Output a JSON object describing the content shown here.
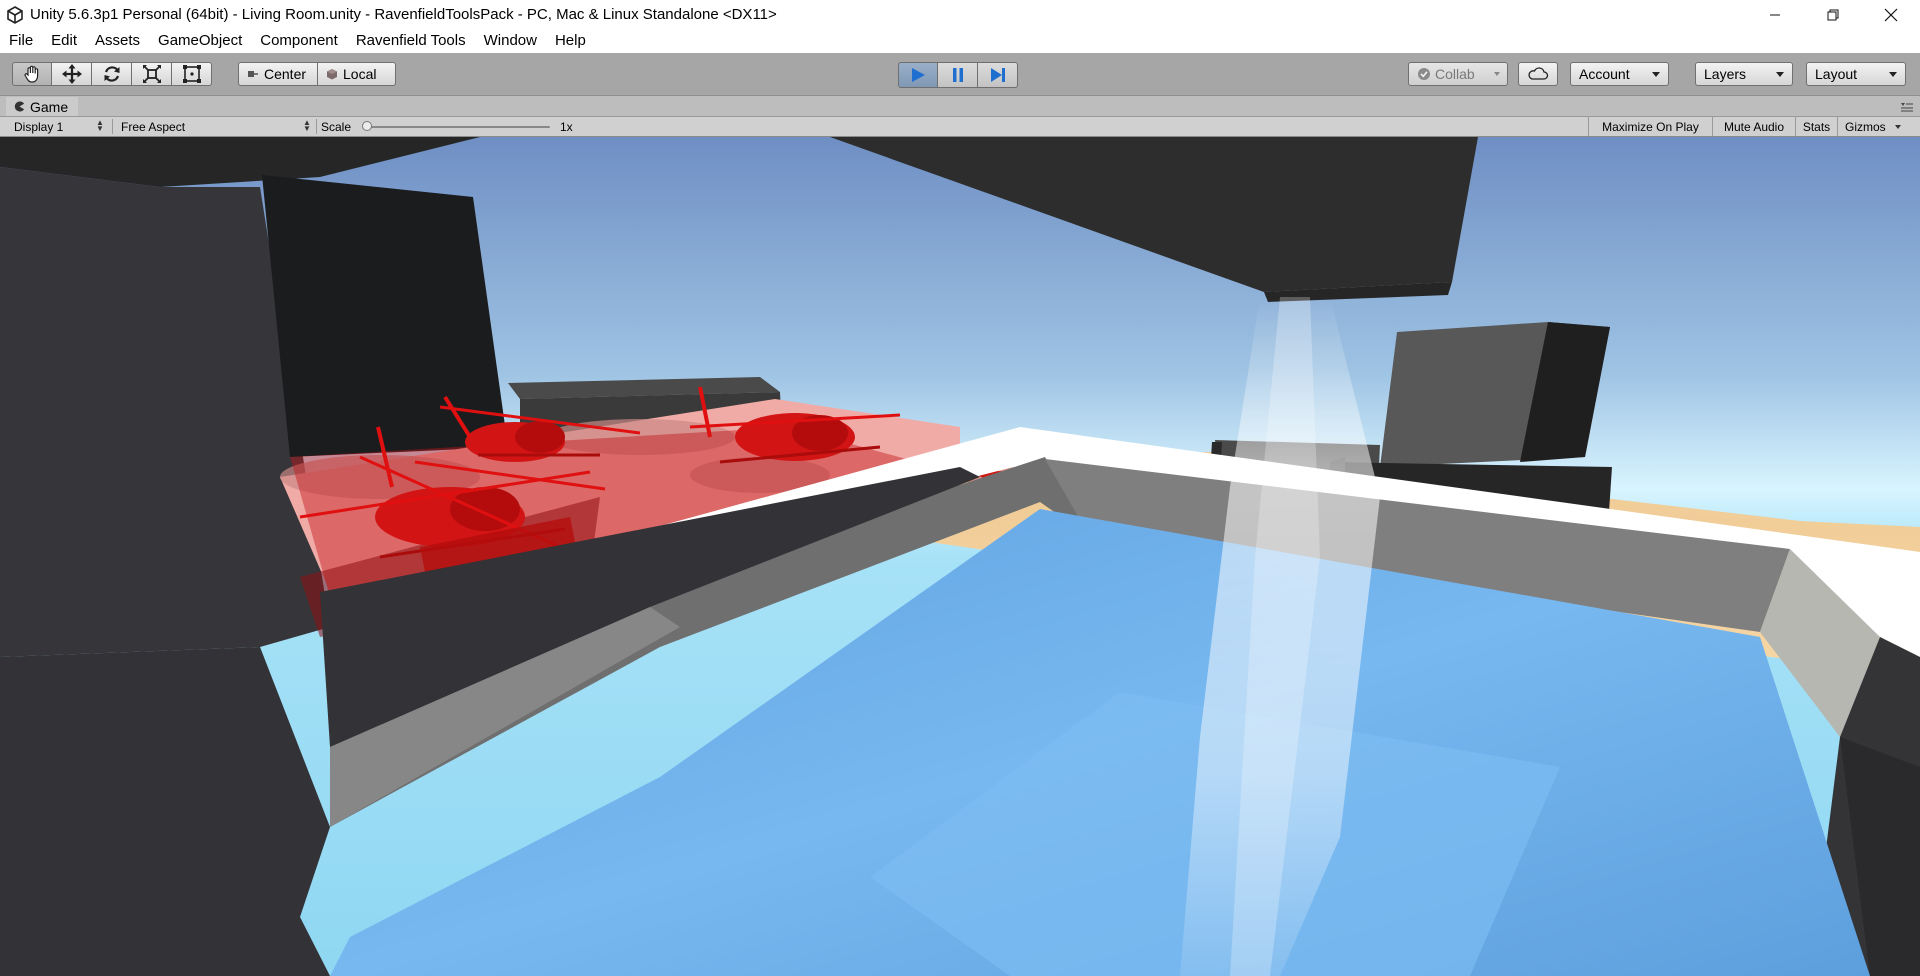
{
  "window": {
    "title": "Unity 5.6.3p1 Personal (64bit) - Living Room.unity - RavenfieldToolsPack - PC, Mac & Linux Standalone <DX11>"
  },
  "menu": {
    "items": [
      "File",
      "Edit",
      "Assets",
      "GameObject",
      "Component",
      "Ravenfield Tools",
      "Window",
      "Help"
    ]
  },
  "toolbar": {
    "tools": [
      "hand-tool-icon",
      "move-tool-icon",
      "rotate-tool-icon",
      "scale-tool-icon",
      "rect-tool-icon"
    ],
    "pivot_mode": "Center",
    "pivot_rotation": "Local",
    "collab": "Collab",
    "account": "Account",
    "layers": "Layers",
    "layout": "Layout"
  },
  "game_view": {
    "tab_label": "Game",
    "display": "Display 1",
    "aspect": "Free Aspect",
    "scale_label": "Scale",
    "scale_value": "1x",
    "scale_level": 0,
    "maximize_on_play": "Maximize On Play",
    "mute_audio": "Mute Audio",
    "stats": "Stats",
    "gizmos": "Gizmos"
  },
  "colors": {
    "toolbar_bg": "#a6a6a6",
    "play_active": "#1f6fd1",
    "sky_top": "#7a9ccf",
    "sand": "#f2cf98",
    "water": "#6aaee8",
    "helicopter_red": "#e01010"
  }
}
